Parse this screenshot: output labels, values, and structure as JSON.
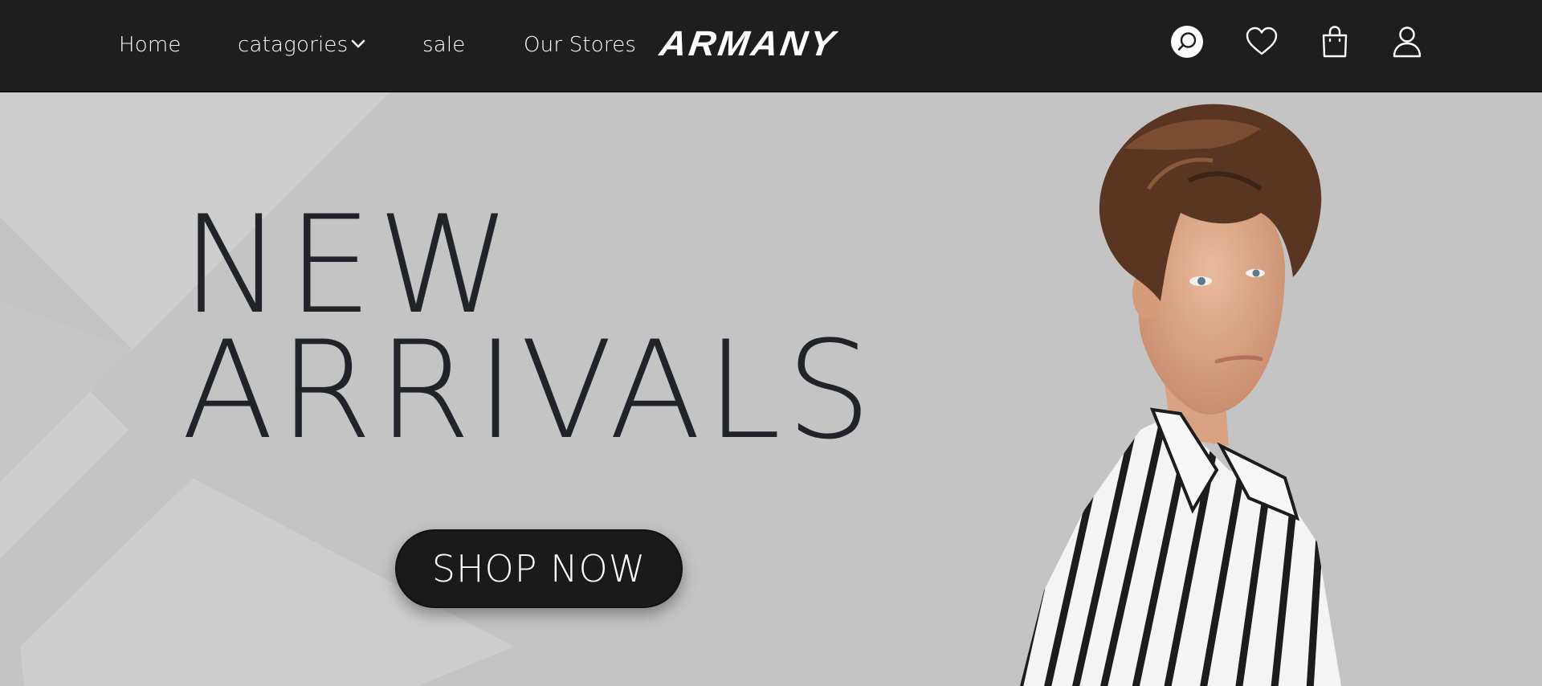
{
  "nav": {
    "links": [
      {
        "label": "Home"
      },
      {
        "label": "catagories"
      },
      {
        "label": "sale"
      },
      {
        "label": "Our Stores"
      }
    ],
    "logo": "ARMANY",
    "icons": [
      "search-icon",
      "heart-icon",
      "shopping-bag-icon",
      "user-icon"
    ]
  },
  "hero": {
    "headline_line1": "NEW",
    "headline_line2": "ARRIVALS",
    "cta_label": "SHOP NOW"
  },
  "colors": {
    "nav_bg": "#1e1e1e",
    "hero_bg": "#c4c4c4",
    "headline": "#202328",
    "button_bg": "#1a1a1a"
  }
}
